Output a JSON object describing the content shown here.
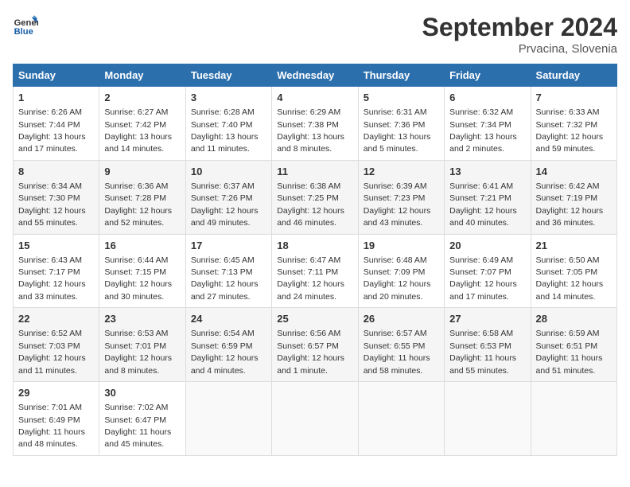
{
  "logo": {
    "line1": "General",
    "line2": "Blue"
  },
  "title": "September 2024",
  "location": "Prvacina, Slovenia",
  "days_of_week": [
    "Sunday",
    "Monday",
    "Tuesday",
    "Wednesday",
    "Thursday",
    "Friday",
    "Saturday"
  ],
  "weeks": [
    [
      {
        "day": "1",
        "sunrise": "Sunrise: 6:26 AM",
        "sunset": "Sunset: 7:44 PM",
        "daylight": "Daylight: 13 hours and 17 minutes."
      },
      {
        "day": "2",
        "sunrise": "Sunrise: 6:27 AM",
        "sunset": "Sunset: 7:42 PM",
        "daylight": "Daylight: 13 hours and 14 minutes."
      },
      {
        "day": "3",
        "sunrise": "Sunrise: 6:28 AM",
        "sunset": "Sunset: 7:40 PM",
        "daylight": "Daylight: 13 hours and 11 minutes."
      },
      {
        "day": "4",
        "sunrise": "Sunrise: 6:29 AM",
        "sunset": "Sunset: 7:38 PM",
        "daylight": "Daylight: 13 hours and 8 minutes."
      },
      {
        "day": "5",
        "sunrise": "Sunrise: 6:31 AM",
        "sunset": "Sunset: 7:36 PM",
        "daylight": "Daylight: 13 hours and 5 minutes."
      },
      {
        "day": "6",
        "sunrise": "Sunrise: 6:32 AM",
        "sunset": "Sunset: 7:34 PM",
        "daylight": "Daylight: 13 hours and 2 minutes."
      },
      {
        "day": "7",
        "sunrise": "Sunrise: 6:33 AM",
        "sunset": "Sunset: 7:32 PM",
        "daylight": "Daylight: 12 hours and 59 minutes."
      }
    ],
    [
      {
        "day": "8",
        "sunrise": "Sunrise: 6:34 AM",
        "sunset": "Sunset: 7:30 PM",
        "daylight": "Daylight: 12 hours and 55 minutes."
      },
      {
        "day": "9",
        "sunrise": "Sunrise: 6:36 AM",
        "sunset": "Sunset: 7:28 PM",
        "daylight": "Daylight: 12 hours and 52 minutes."
      },
      {
        "day": "10",
        "sunrise": "Sunrise: 6:37 AM",
        "sunset": "Sunset: 7:26 PM",
        "daylight": "Daylight: 12 hours and 49 minutes."
      },
      {
        "day": "11",
        "sunrise": "Sunrise: 6:38 AM",
        "sunset": "Sunset: 7:25 PM",
        "daylight": "Daylight: 12 hours and 46 minutes."
      },
      {
        "day": "12",
        "sunrise": "Sunrise: 6:39 AM",
        "sunset": "Sunset: 7:23 PM",
        "daylight": "Daylight: 12 hours and 43 minutes."
      },
      {
        "day": "13",
        "sunrise": "Sunrise: 6:41 AM",
        "sunset": "Sunset: 7:21 PM",
        "daylight": "Daylight: 12 hours and 40 minutes."
      },
      {
        "day": "14",
        "sunrise": "Sunrise: 6:42 AM",
        "sunset": "Sunset: 7:19 PM",
        "daylight": "Daylight: 12 hours and 36 minutes."
      }
    ],
    [
      {
        "day": "15",
        "sunrise": "Sunrise: 6:43 AM",
        "sunset": "Sunset: 7:17 PM",
        "daylight": "Daylight: 12 hours and 33 minutes."
      },
      {
        "day": "16",
        "sunrise": "Sunrise: 6:44 AM",
        "sunset": "Sunset: 7:15 PM",
        "daylight": "Daylight: 12 hours and 30 minutes."
      },
      {
        "day": "17",
        "sunrise": "Sunrise: 6:45 AM",
        "sunset": "Sunset: 7:13 PM",
        "daylight": "Daylight: 12 hours and 27 minutes."
      },
      {
        "day": "18",
        "sunrise": "Sunrise: 6:47 AM",
        "sunset": "Sunset: 7:11 PM",
        "daylight": "Daylight: 12 hours and 24 minutes."
      },
      {
        "day": "19",
        "sunrise": "Sunrise: 6:48 AM",
        "sunset": "Sunset: 7:09 PM",
        "daylight": "Daylight: 12 hours and 20 minutes."
      },
      {
        "day": "20",
        "sunrise": "Sunrise: 6:49 AM",
        "sunset": "Sunset: 7:07 PM",
        "daylight": "Daylight: 12 hours and 17 minutes."
      },
      {
        "day": "21",
        "sunrise": "Sunrise: 6:50 AM",
        "sunset": "Sunset: 7:05 PM",
        "daylight": "Daylight: 12 hours and 14 minutes."
      }
    ],
    [
      {
        "day": "22",
        "sunrise": "Sunrise: 6:52 AM",
        "sunset": "Sunset: 7:03 PM",
        "daylight": "Daylight: 12 hours and 11 minutes."
      },
      {
        "day": "23",
        "sunrise": "Sunrise: 6:53 AM",
        "sunset": "Sunset: 7:01 PM",
        "daylight": "Daylight: 12 hours and 8 minutes."
      },
      {
        "day": "24",
        "sunrise": "Sunrise: 6:54 AM",
        "sunset": "Sunset: 6:59 PM",
        "daylight": "Daylight: 12 hours and 4 minutes."
      },
      {
        "day": "25",
        "sunrise": "Sunrise: 6:56 AM",
        "sunset": "Sunset: 6:57 PM",
        "daylight": "Daylight: 12 hours and 1 minute."
      },
      {
        "day": "26",
        "sunrise": "Sunrise: 6:57 AM",
        "sunset": "Sunset: 6:55 PM",
        "daylight": "Daylight: 11 hours and 58 minutes."
      },
      {
        "day": "27",
        "sunrise": "Sunrise: 6:58 AM",
        "sunset": "Sunset: 6:53 PM",
        "daylight": "Daylight: 11 hours and 55 minutes."
      },
      {
        "day": "28",
        "sunrise": "Sunrise: 6:59 AM",
        "sunset": "Sunset: 6:51 PM",
        "daylight": "Daylight: 11 hours and 51 minutes."
      }
    ],
    [
      {
        "day": "29",
        "sunrise": "Sunrise: 7:01 AM",
        "sunset": "Sunset: 6:49 PM",
        "daylight": "Daylight: 11 hours and 48 minutes."
      },
      {
        "day": "30",
        "sunrise": "Sunrise: 7:02 AM",
        "sunset": "Sunset: 6:47 PM",
        "daylight": "Daylight: 11 hours and 45 minutes."
      },
      null,
      null,
      null,
      null,
      null
    ]
  ]
}
